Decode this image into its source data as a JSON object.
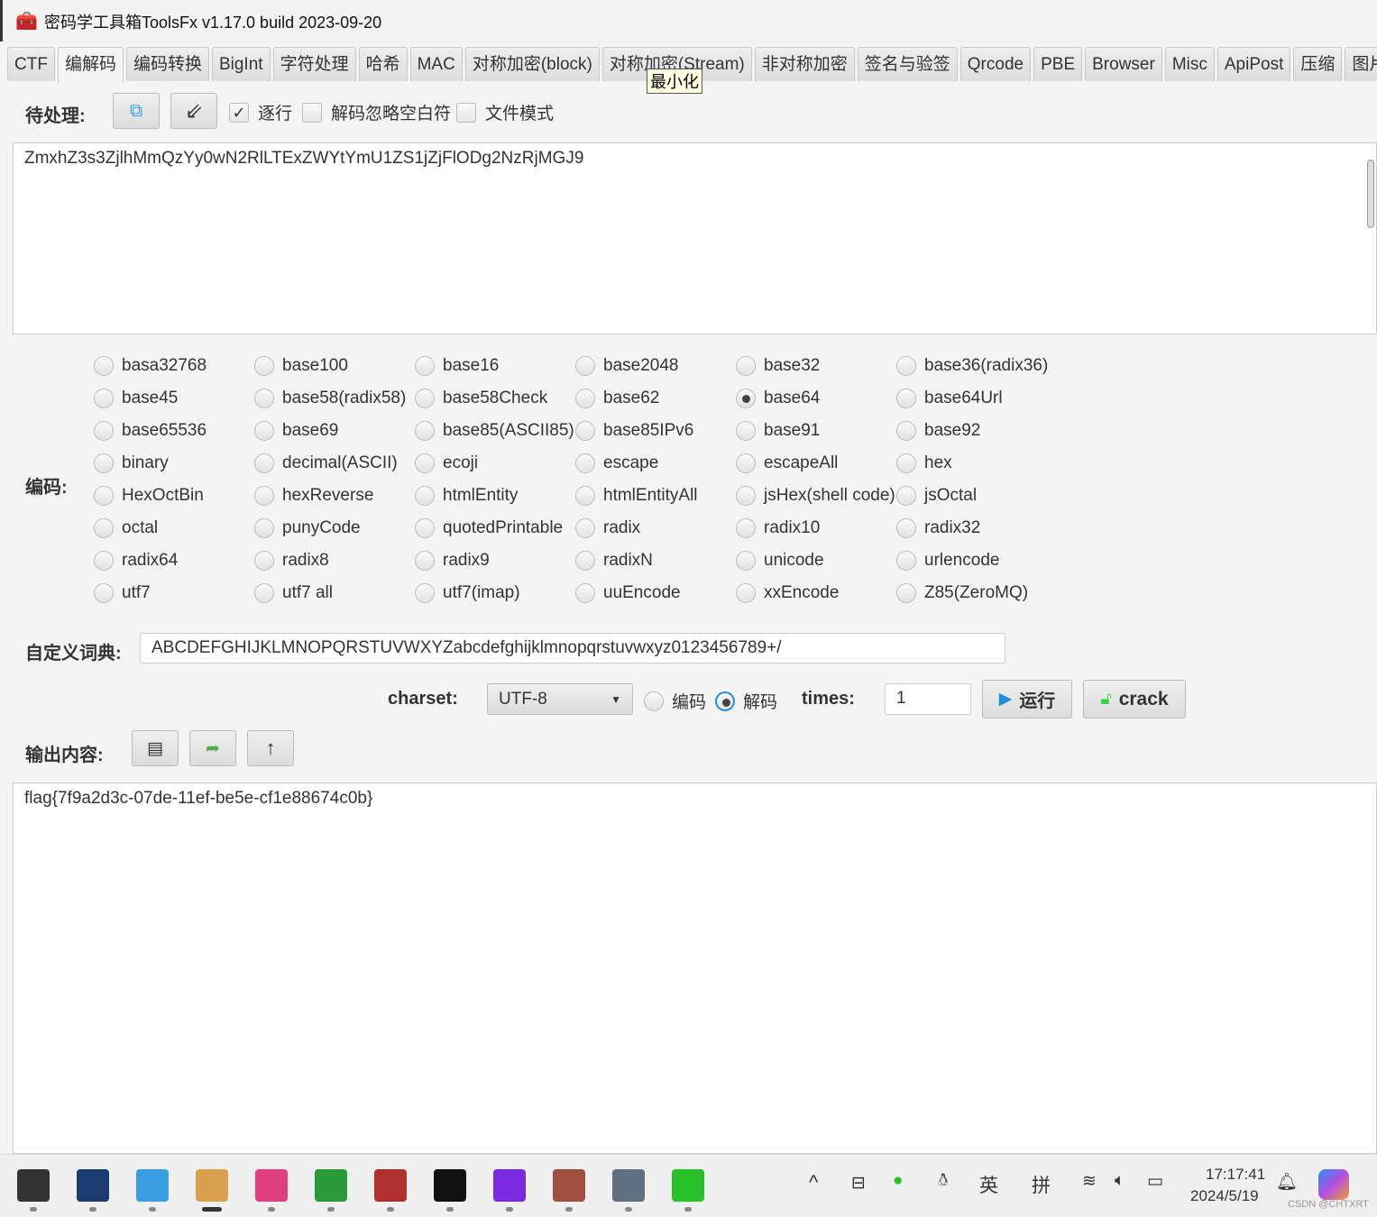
{
  "window": {
    "title": "密码学工具箱ToolsFx v1.17.0 build 2023-09-20",
    "icon": "toolbox-icon"
  },
  "tabs": [
    {
      "label": "CTF"
    },
    {
      "label": "编解码",
      "active": true
    },
    {
      "label": "编码转换"
    },
    {
      "label": "BigInt"
    },
    {
      "label": "字符处理"
    },
    {
      "label": "哈希"
    },
    {
      "label": "MAC"
    },
    {
      "label": "对称加密(block)"
    },
    {
      "label": "对称加密(Stream)"
    },
    {
      "label": "非对称加密"
    },
    {
      "label": "签名与验签"
    },
    {
      "label": "Qrcode"
    },
    {
      "label": "PBE"
    },
    {
      "label": "Browser"
    },
    {
      "label": "Misc"
    },
    {
      "label": "ApiPost"
    },
    {
      "label": "压缩"
    },
    {
      "label": "图片模块"
    }
  ],
  "tooltip": "最小化",
  "input_section": {
    "label": "待处理:",
    "line_by_line": {
      "label": "逐行",
      "checked": true
    },
    "ignore_whitespace": {
      "label": "解码忽略空白符",
      "checked": false
    },
    "file_mode": {
      "label": "文件模式",
      "checked": false
    },
    "text": "ZmxhZ3s3ZjlhMmQzYy0wN2RlLTExZWYtYmU1ZS1jZjFlODg2NzRjMGJ9"
  },
  "encoding": {
    "label": "编码:",
    "selected": "base64",
    "options": [
      "basa32768",
      "base100",
      "base16",
      "base2048",
      "base32",
      "base36(radix36)",
      "base45",
      "base58(radix58)",
      "base58Check",
      "base62",
      "base64",
      "base64Url",
      "base65536",
      "base69",
      "base85(ASCII85)",
      "base85IPv6",
      "base91",
      "base92",
      "binary",
      "decimal(ASCII)",
      "ecoji",
      "escape",
      "escapeAll",
      "hex",
      "HexOctBin",
      "hexReverse",
      "htmlEntity",
      "htmlEntityAll",
      "jsHex(shell code)",
      "jsOctal",
      "octal",
      "punyCode",
      "quotedPrintable",
      "radix",
      "radix10",
      "radix32",
      "radix64",
      "radix8",
      "radix9",
      "radixN",
      "unicode",
      "urlencode",
      "utf7",
      "utf7 all",
      "utf7(imap)",
      "uuEncode",
      "xxEncode",
      "Z85(ZeroMQ)"
    ]
  },
  "custom_dict": {
    "label": "自定义词典:",
    "value": "ABCDEFGHIJKLMNOPQRSTUVWXYZabcdefghijklmnopqrstuvwxyz0123456789+/"
  },
  "controls": {
    "charset_label": "charset:",
    "charset": "UTF-8",
    "encode_label": "编码",
    "decode_label": "解码",
    "mode": "decode",
    "times_label": "times:",
    "times": "1",
    "run_label": "运行",
    "crack_label": "crack"
  },
  "output_section": {
    "label": "输出内容:",
    "text": "flag{7f9a2d3c-07de-11ef-be5e-cf1e88674c0b}"
  },
  "taskbar": {
    "apps": [
      "terminal",
      "cat-app",
      "waveform-app",
      "toolsfx",
      "baidu-netdisk",
      "download-manager",
      "winrar",
      "burp",
      "hex-editor",
      "portrait-app",
      "calculator",
      "wechat"
    ],
    "tray": {
      "ime1": "英",
      "ime2": "拼",
      "time": "17:17:41",
      "date": "2024/5/19"
    },
    "watermark": "CSDN @CHTXRT"
  },
  "colors": {
    "accent": "#1e90d8",
    "crack": "#3ad13a"
  }
}
